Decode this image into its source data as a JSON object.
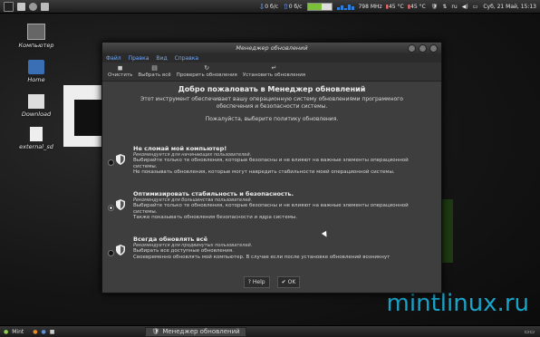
{
  "top_panel": {
    "net_down": "0 б/с",
    "net_up": "0 б/с",
    "memory_fill": 0.55,
    "cpu_freq": "798 MHz",
    "temp1": "45 °C",
    "temp2": "45 °C",
    "lang": "ru",
    "clock": "Суб, 21 Май, 15:13"
  },
  "desktop_icons": [
    {
      "label": "Компьютер"
    },
    {
      "label": "Home"
    },
    {
      "label": "Download"
    },
    {
      "label": "external_sd"
    }
  ],
  "watermark": "mintlinux.ru",
  "window": {
    "title": "Менеджер обновлений",
    "menu": [
      "Файл",
      "Правка",
      "Вид",
      "Справка"
    ],
    "toolbar": [
      {
        "icon": "clear-icon",
        "glyph": "◼",
        "label": "Очистить"
      },
      {
        "icon": "select-all-icon",
        "glyph": "▤",
        "label": "Выбрать всё"
      },
      {
        "icon": "refresh-icon",
        "glyph": "↻",
        "label": "Проверить обновления"
      },
      {
        "icon": "install-icon",
        "glyph": "↵",
        "label": "Установить обновления"
      }
    ],
    "welcome_title": "Добро пожаловать в Менеджер обновлений",
    "intro_line1": "Этот инструмент обеспечивает вашу операционную систему обновлениями программного",
    "intro_line2": "обеспечения и безопасности системы.",
    "choose_policy": "Пожалуйста, выберите политику обновления.",
    "options": [
      {
        "title": "Не сломай мой компьютер!",
        "recommended": "Рекомендуется для начинающих пользователей.",
        "line1": "Выбирайте только те обновления, которые безопасны и не влияют на важные элементы операционной",
        "line2": "системы.",
        "line3": "Не показывать обновления, которые могут навредить стабильности моей операционной системы.",
        "checked": false
      },
      {
        "title": "Оптимизировать стабильность и безопасность.",
        "recommended": "Рекомендуется для большинства пользователей.",
        "line1": "Выбирайте только те обновления, которые безопасны и не влияют на важные элементы операционной",
        "line2": "системы.",
        "line3": "Также показывать обновления безопасности и ядра системы.",
        "checked": true
      },
      {
        "title": "Всегда обновлять всё",
        "recommended": "Рекомендуется для продвинутых пользователей.",
        "line1": "Выбирать все доступные обновления.",
        "line2": "Своевременно обновлять мой компьютер. В случае если после установке обновлений возникнут",
        "line3": "",
        "checked": false
      }
    ],
    "help_label": "Help",
    "ok_label": "OK"
  },
  "bottom_panel": {
    "menu_label": "Mint",
    "task_label": "Менеджер обновлений"
  }
}
